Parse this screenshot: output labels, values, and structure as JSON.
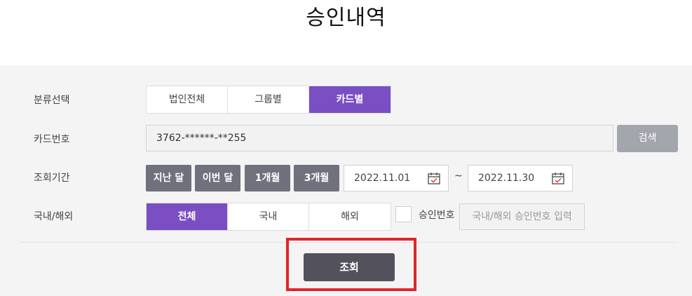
{
  "page_title": "승인내역",
  "filters": {
    "category": {
      "label": "분류선택",
      "options": [
        "법인전체",
        "그룹별",
        "카드별"
      ],
      "selected": "카드별"
    },
    "card_number": {
      "label": "카드번호",
      "value": "3762-******-**255",
      "search_button": "검색"
    },
    "period": {
      "label": "조회기간",
      "quick_buttons": [
        "지난 달",
        "이번 달",
        "1개월",
        "3개월"
      ],
      "start_date": "2022.11.01",
      "separator": "~",
      "end_date": "2022.11.30"
    },
    "region": {
      "label": "국내/해외",
      "options": [
        "전체",
        "국내",
        "해외"
      ],
      "selected": "전체",
      "approval_checkbox_label": "승인번호",
      "approval_placeholder": "국내/해외 승인번호 입력"
    }
  },
  "query_button": "조회",
  "colors": {
    "accent": "#7a4fc4",
    "panel_bg": "#f4f4f4",
    "dark_button": "#53525c",
    "period_button": "#6f727c",
    "search_button": "#a3a6ad",
    "highlight": "#e1252b"
  }
}
